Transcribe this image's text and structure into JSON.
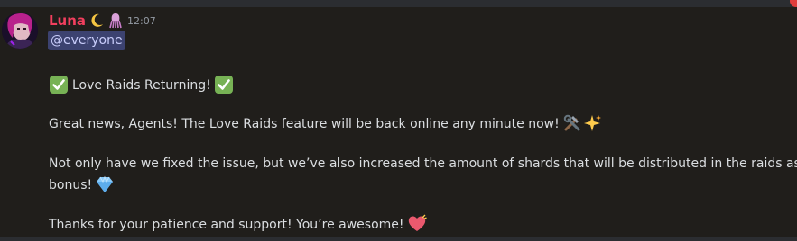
{
  "message": {
    "author": "Luna",
    "author_icons": [
      "crescent-moon-icon",
      "squid-icon"
    ],
    "timestamp": "12:07",
    "mention": "@everyone",
    "title": "Love Raids Returning!",
    "paragraph1": "Great news, Agents! The Love Raids feature will be back online any minute now!",
    "paragraph2_line1": "Not only have we fixed the issue, but we’ve also increased the amount of shards that will be distributed in the raids as a",
    "paragraph2_line2": "bonus!",
    "paragraph3": "Thanks for your patience and support! You’re awesome!",
    "emojis": [
      "check-mark-icon",
      "hammer-and-wrench-icon",
      "sparkles-icon",
      "gem-icon",
      "heart-icon"
    ]
  },
  "colors": {
    "background": "#201e1b",
    "author": "#f23f5e",
    "mention_bg": "#3c4270",
    "mention_text": "#c9cdfb",
    "text": "#dbdee1",
    "timestamp": "#949ba4"
  }
}
